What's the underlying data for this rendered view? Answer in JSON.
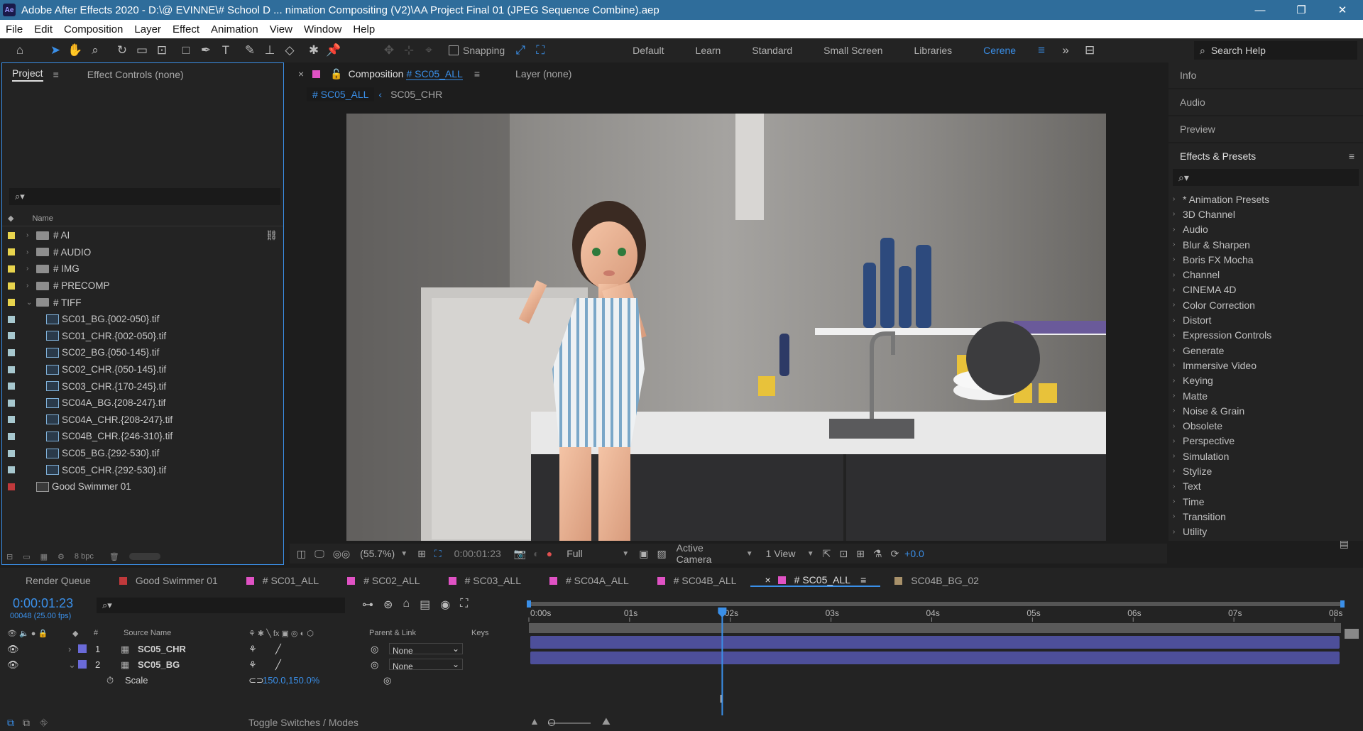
{
  "app": {
    "title": "Adobe After Effects 2020 - D:\\@ EVINNE\\# School D ... nimation Compositing (V2)\\AA Project Final 01 (JPEG Sequence Combine).aep",
    "logo": "Ae"
  },
  "window_controls": [
    "—",
    "❐",
    "✕"
  ],
  "menu": [
    "File",
    "Edit",
    "Composition",
    "Layer",
    "Effect",
    "Animation",
    "View",
    "Window",
    "Help"
  ],
  "toolbar": {
    "snapping_label": "Snapping",
    "workspaces": [
      "Default",
      "Learn",
      "Standard",
      "Small Screen",
      "Libraries",
      "Cerene"
    ],
    "active_workspace": "Cerene",
    "search_help_placeholder": "Search Help"
  },
  "project_panel": {
    "tab_project": "Project",
    "tab_effect_controls": "Effect Controls (none)",
    "search_placeholder": "",
    "name_header": "Name",
    "items": [
      {
        "name": "# AI",
        "type": "folder",
        "label_color": "#e8d44d",
        "expanded": false,
        "indent": 0
      },
      {
        "name": "# AUDIO",
        "type": "folder",
        "label_color": "#e8d44d",
        "expanded": false,
        "indent": 0
      },
      {
        "name": "# IMG",
        "type": "folder",
        "label_color": "#e8d44d",
        "expanded": false,
        "indent": 0
      },
      {
        "name": "# PRECOMP",
        "type": "folder",
        "label_color": "#e8d44d",
        "expanded": false,
        "indent": 0
      },
      {
        "name": "# TIFF",
        "type": "folder",
        "label_color": "#e8d44d",
        "expanded": true,
        "indent": 0
      },
      {
        "name": "SC01_BG.{002-050}.tif",
        "type": "sequence",
        "label_color": "#a7c8cf",
        "indent": 1
      },
      {
        "name": "SC01_CHR.{002-050}.tif",
        "type": "sequence",
        "label_color": "#a7c8cf",
        "indent": 1
      },
      {
        "name": "SC02_BG.{050-145}.tif",
        "type": "sequence",
        "label_color": "#a7c8cf",
        "indent": 1
      },
      {
        "name": "SC02_CHR.{050-145}.tif",
        "type": "sequence",
        "label_color": "#a7c8cf",
        "indent": 1
      },
      {
        "name": "SC03_CHR.{170-245}.tif",
        "type": "sequence",
        "label_color": "#a7c8cf",
        "indent": 1
      },
      {
        "name": "SC04A_BG.{208-247}.tif",
        "type": "sequence",
        "label_color": "#a7c8cf",
        "indent": 1
      },
      {
        "name": "SC04A_CHR.{208-247}.tif",
        "type": "sequence",
        "label_color": "#a7c8cf",
        "indent": 1
      },
      {
        "name": "SC04B_CHR.{246-310}.tif",
        "type": "sequence",
        "label_color": "#a7c8cf",
        "indent": 1
      },
      {
        "name": "SC05_BG.{292-530}.tif",
        "type": "sequence",
        "label_color": "#a7c8cf",
        "indent": 1
      },
      {
        "name": "SC05_CHR.{292-530}.tif",
        "type": "sequence",
        "label_color": "#a7c8cf",
        "indent": 1
      },
      {
        "name": "Good Swimmer 01",
        "type": "composition",
        "label_color": "#c0393b",
        "indent": 0
      }
    ],
    "bpc": "8 bpc"
  },
  "comp_panel": {
    "tab_label": "Composition",
    "tab_comp_name": "# SC05_ALL",
    "layer_tab": "Layer  (none)",
    "breadcrumb_active": "# SC05_ALL",
    "breadcrumb_next": "SC05_CHR",
    "zoom": "(55.7%)",
    "timecode": "0:00:01:23",
    "resolution": "Full",
    "camera": "Active Camera",
    "views": "1 View",
    "exposure": "+0.0"
  },
  "right_panel": {
    "sections": [
      "Info",
      "Audio",
      "Preview",
      "Effects & Presets"
    ],
    "effects_search_placeholder": "",
    "effects": [
      "* Animation Presets",
      "3D Channel",
      "Audio",
      "Blur & Sharpen",
      "Boris FX Mocha",
      "Channel",
      "CINEMA 4D",
      "Color Correction",
      "Distort",
      "Expression Controls",
      "Generate",
      "Immersive Video",
      "Keying",
      "Matte",
      "Noise & Grain",
      "Obsolete",
      "Perspective",
      "Simulation",
      "Stylize",
      "Text",
      "Time",
      "Transition",
      "Utility"
    ]
  },
  "timeline": {
    "tabs": [
      {
        "label": "Render Queue",
        "color": "",
        "active": false
      },
      {
        "label": "Good Swimmer 01",
        "color": "#c0393b",
        "active": false
      },
      {
        "label": "# SC01_ALL",
        "color": "#e052c4",
        "active": false
      },
      {
        "label": "# SC02_ALL",
        "color": "#e052c4",
        "active": false
      },
      {
        "label": "# SC03_ALL",
        "color": "#e052c4",
        "active": false
      },
      {
        "label": "# SC04A_ALL",
        "color": "#e052c4",
        "active": false
      },
      {
        "label": "# SC04B_ALL",
        "color": "#e052c4",
        "active": false
      },
      {
        "label": "# SC05_ALL",
        "color": "#e052c4",
        "active": true
      },
      {
        "label": "SC04B_BG_02",
        "color": "#a8916a",
        "active": false
      }
    ],
    "timecode": "0:00:01:23",
    "frame_info": "00048 (25.00 fps)",
    "search_placeholder": "",
    "col_number": "#",
    "col_source_name": "Source Name",
    "col_parent": "Parent & Link",
    "col_keys": "Keys",
    "layers": [
      {
        "num": "1",
        "name": "SC05_CHR",
        "parent": "None",
        "expanded": false
      },
      {
        "num": "2",
        "name": "SC05_BG",
        "parent": "None",
        "expanded": true
      }
    ],
    "property": {
      "name": "Scale",
      "value": "150.0,150.0%"
    },
    "ruler_ticks": [
      "0:00s",
      "01s",
      "02s",
      "03s",
      "04s",
      "05s",
      "06s",
      "07s",
      "08s"
    ],
    "playhead_seconds": 1.92,
    "duration_seconds": 8,
    "toggle_label": "Toggle Switches / Modes"
  }
}
